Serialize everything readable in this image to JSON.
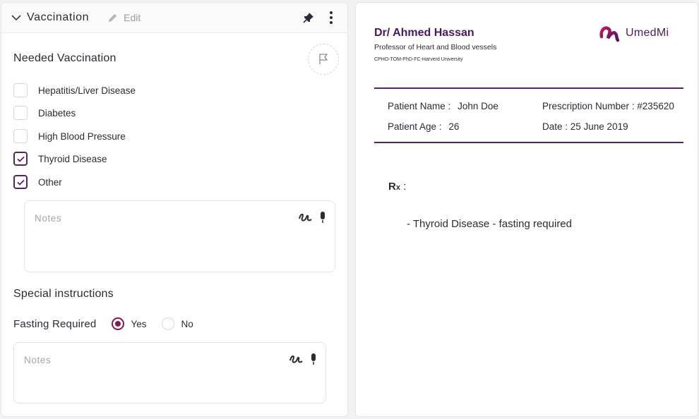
{
  "header": {
    "title": "Vaccination",
    "edit_label": "Edit"
  },
  "needed_vaccination": {
    "title": "Needed Vaccination",
    "items": [
      {
        "label": "Hepatitis/Liver Disease",
        "checked": false
      },
      {
        "label": "Diabetes",
        "checked": false
      },
      {
        "label": "High Blood Pressure",
        "checked": false
      },
      {
        "label": "Thyroid Disease",
        "checked": true
      },
      {
        "label": "Other",
        "checked": true
      }
    ],
    "notes_placeholder": "Notes"
  },
  "special_instructions": {
    "title": "Special instructions",
    "fasting_label": "Fasting Required",
    "options": [
      {
        "label": "Yes",
        "selected": true
      },
      {
        "label": "No",
        "selected": false
      }
    ],
    "notes_placeholder": "Notes"
  },
  "prescription": {
    "doctor_name": "Dr/ Ahmed Hassan",
    "doctor_title": "Professor of Heart and Blood vessels",
    "doctor_credentials": "CPHO-TOM-PhD-FC-Harverd University",
    "brand": "UmedMi",
    "patient_name_label": "Patient Name :",
    "patient_name": "John Doe",
    "patient_age_label": "Patient Age :",
    "patient_age": "26",
    "prescription_number": "Prescription Number : #235620",
    "date": "Date : 25 June 2019",
    "rx_label": "R",
    "rx_sub": "x",
    "rx_colon": ":",
    "rx_line": "- Thyroid Disease - fasting required"
  },
  "colors": {
    "brand_purple": "#4a1766",
    "radio_active": "#8a1553",
    "checkbox_active": "#5b1f6b"
  }
}
